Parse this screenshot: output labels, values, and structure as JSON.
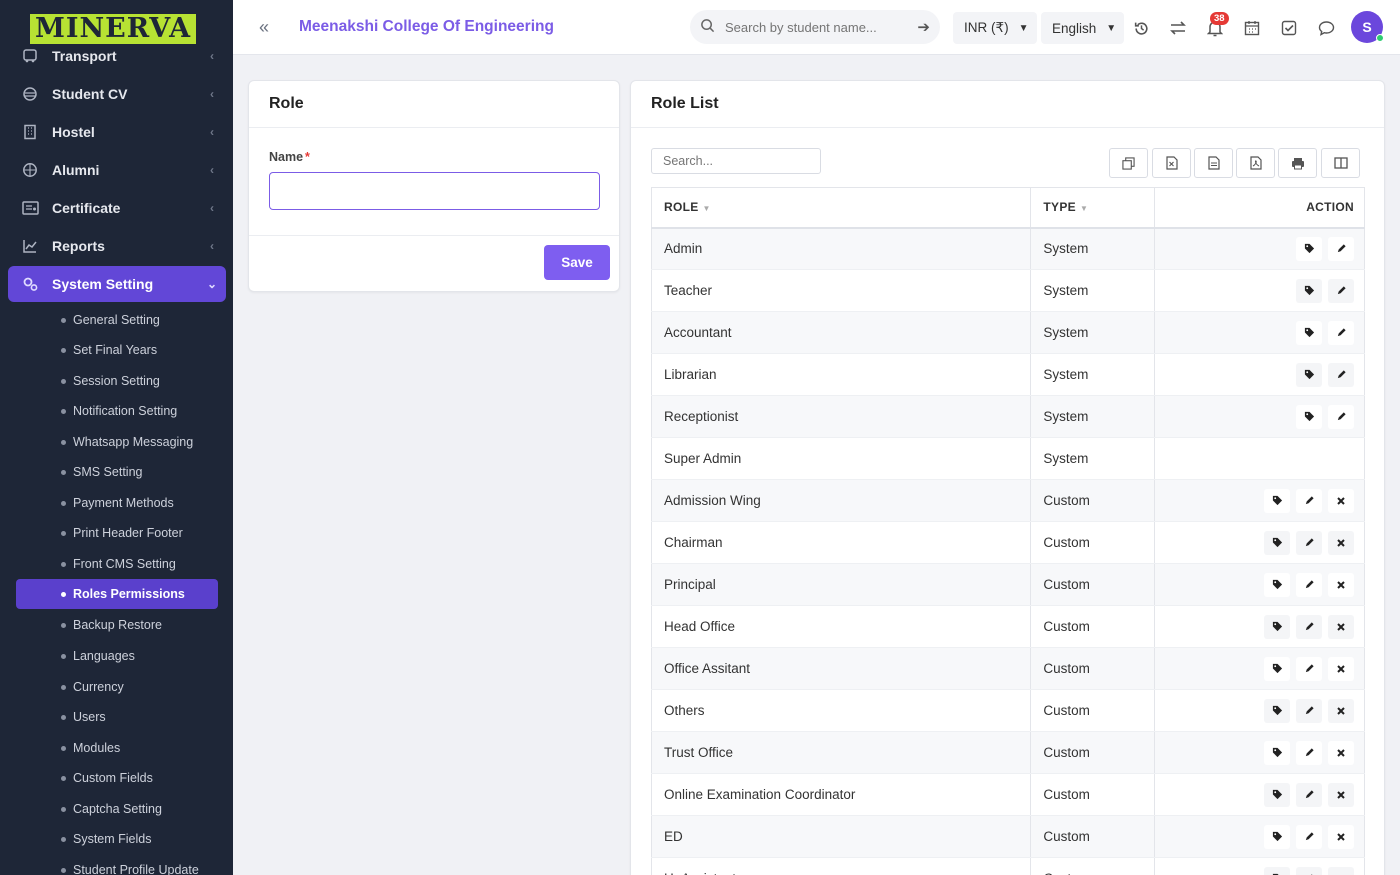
{
  "sidebar": {
    "logo": "MINERVA",
    "nav": [
      {
        "label": "Transport",
        "icon": "bus-icon"
      },
      {
        "label": "Student CV",
        "icon": "cv-icon"
      },
      {
        "label": "Hostel",
        "icon": "building-icon"
      },
      {
        "label": "Alumni",
        "icon": "globe-icon"
      },
      {
        "label": "Certificate",
        "icon": "certificate-icon"
      },
      {
        "label": "Reports",
        "icon": "chart-line-icon"
      },
      {
        "label": "System Setting",
        "icon": "gears-icon"
      }
    ],
    "sub": [
      "General Setting",
      "Set Final Years",
      "Session Setting",
      "Notification Setting",
      "Whatsapp Messaging",
      "SMS Setting",
      "Payment Methods",
      "Print Header Footer",
      "Front CMS Setting",
      "Roles Permissions",
      "Backup Restore",
      "Languages",
      "Currency",
      "Users",
      "Modules",
      "Custom Fields",
      "Captcha Setting",
      "System Fields",
      "Student Profile Update"
    ],
    "active_sub": "Roles Permissions"
  },
  "header": {
    "college": "Meenakshi College Of Engineering",
    "search_placeholder": "Search by student name...",
    "currency": "INR (₹)",
    "language": "English",
    "notification_count": "38",
    "avatar_initial": "S"
  },
  "role_form": {
    "title": "Role",
    "name_label": "Name",
    "required_mark": "*",
    "name_value": "",
    "save_label": "Save"
  },
  "role_list": {
    "title": "Role List",
    "search_placeholder": "Search...",
    "columns": {
      "role": "ROLE",
      "type": "TYPE",
      "action": "ACTION"
    },
    "rows": [
      {
        "role": "Admin",
        "type": "System",
        "actions": [
          "tag",
          "edit"
        ]
      },
      {
        "role": "Teacher",
        "type": "System",
        "actions": [
          "tag",
          "edit"
        ]
      },
      {
        "role": "Accountant",
        "type": "System",
        "actions": [
          "tag",
          "edit"
        ]
      },
      {
        "role": "Librarian",
        "type": "System",
        "actions": [
          "tag",
          "edit"
        ]
      },
      {
        "role": "Receptionist",
        "type": "System",
        "actions": [
          "tag",
          "edit"
        ]
      },
      {
        "role": "Super Admin",
        "type": "System",
        "actions": []
      },
      {
        "role": "Admission Wing",
        "type": "Custom",
        "actions": [
          "tag",
          "edit",
          "delete"
        ]
      },
      {
        "role": "Chairman",
        "type": "Custom",
        "actions": [
          "tag",
          "edit",
          "delete"
        ]
      },
      {
        "role": "Principal",
        "type": "Custom",
        "actions": [
          "tag",
          "edit",
          "delete"
        ]
      },
      {
        "role": "Head Office",
        "type": "Custom",
        "actions": [
          "tag",
          "edit",
          "delete"
        ]
      },
      {
        "role": "Office Assitant",
        "type": "Custom",
        "actions": [
          "tag",
          "edit",
          "delete"
        ]
      },
      {
        "role": "Others",
        "type": "Custom",
        "actions": [
          "tag",
          "edit",
          "delete"
        ]
      },
      {
        "role": "Trust Office",
        "type": "Custom",
        "actions": [
          "tag",
          "edit",
          "delete"
        ]
      },
      {
        "role": "Online Examination Coordinator",
        "type": "Custom",
        "actions": [
          "tag",
          "edit",
          "delete"
        ]
      },
      {
        "role": "ED",
        "type": "Custom",
        "actions": [
          "tag",
          "edit",
          "delete"
        ]
      },
      {
        "role": "Hr Assistant",
        "type": "Custom",
        "actions": [
          "tag",
          "edit",
          "delete"
        ]
      }
    ]
  }
}
